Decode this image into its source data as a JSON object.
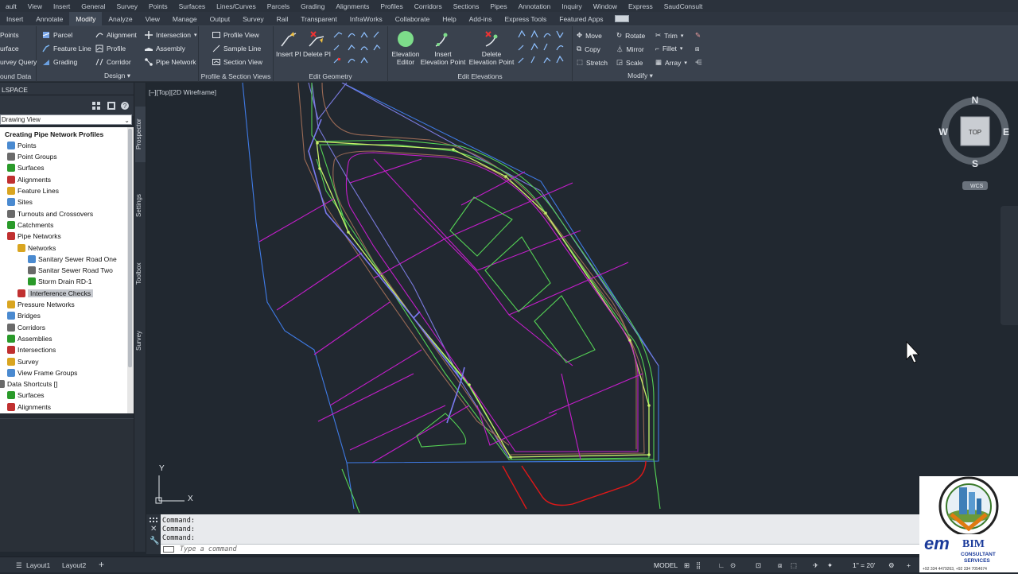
{
  "menubar": [
    "ault",
    "View",
    "Insert",
    "General",
    "Survey",
    "Points",
    "Surfaces",
    "Lines/Curves",
    "Parcels",
    "Grading",
    "Alignments",
    "Profiles",
    "Corridors",
    "Sections",
    "Pipes",
    "Annotation",
    "Inquiry",
    "Window",
    "Express",
    "SaudConsult"
  ],
  "ribbon_tabs": [
    "Insert",
    "Annotate",
    "Modify",
    "Analyze",
    "View",
    "Manage",
    "Output",
    "Survey",
    "Rail",
    "Transparent",
    "InfraWorks",
    "Collaborate",
    "Help",
    "Add-ins",
    "Express Tools",
    "Featured Apps"
  ],
  "active_tab": "Modify",
  "ribbon": {
    "ground": {
      "items": [
        "Points",
        "urface",
        "urvey Query"
      ],
      "title": "ound Data"
    },
    "design": {
      "col1": [
        "Parcel",
        "Feature Line",
        "Grading"
      ],
      "col2": [
        "Alignment",
        "Profile",
        "Corridor"
      ],
      "col3": [
        "Intersection",
        "Assembly",
        "Pipe Network"
      ],
      "title": "Design"
    },
    "psviews": {
      "items": [
        "Profile View",
        "Sample Line",
        "Section View"
      ],
      "title": "Profile & Section Views"
    },
    "geometry": {
      "insert_pi": "Insert PI",
      "delete_pi": "Delete PI",
      "title": "Edit Geometry"
    },
    "elevations": {
      "editor": "Elevation Editor",
      "insert": "Insert Elevation Point",
      "delete": "Delete Elevation Point",
      "title": "Edit Elevations"
    },
    "modify": {
      "col1": [
        "Move",
        "Copy",
        "Stretch"
      ],
      "col2": [
        "Rotate",
        "Mirror",
        "Scale"
      ],
      "col3": [
        "Trim",
        "Fillet",
        "Array"
      ],
      "title": "Modify"
    }
  },
  "toolspace": {
    "header": "LSPACE",
    "view_select": "Drawing View",
    "tree": [
      {
        "label": "Creating Pipe Network Profiles",
        "bold": true,
        "indent": 0
      },
      {
        "label": "Points",
        "indent": 1
      },
      {
        "label": "Point Groups",
        "indent": 1
      },
      {
        "label": "Surfaces",
        "indent": 1
      },
      {
        "label": "Alignments",
        "indent": 1
      },
      {
        "label": "Feature Lines",
        "indent": 1
      },
      {
        "label": "Sites",
        "indent": 1
      },
      {
        "label": "Turnouts and Crossovers",
        "indent": 1
      },
      {
        "label": "Catchments",
        "indent": 1
      },
      {
        "label": "Pipe Networks",
        "indent": 1
      },
      {
        "label": "Networks",
        "indent": 2
      },
      {
        "label": "Sanitary Sewer Road One",
        "indent": 3
      },
      {
        "label": "Sanitar Sewer Road Two",
        "indent": 3
      },
      {
        "label": "Storm Drain RD-1",
        "indent": 3
      },
      {
        "label": "Interference Checks",
        "indent": 2,
        "selected": true
      },
      {
        "label": "Pressure Networks",
        "indent": 1
      },
      {
        "label": "Bridges",
        "indent": 1
      },
      {
        "label": "Corridors",
        "indent": 1
      },
      {
        "label": "Assemblies",
        "indent": 1
      },
      {
        "label": "Intersections",
        "indent": 1
      },
      {
        "label": "Survey",
        "indent": 1
      },
      {
        "label": "View Frame Groups",
        "indent": 1
      },
      {
        "label": "Data Shortcuts []",
        "indent": 0
      },
      {
        "label": "Surfaces",
        "indent": 1
      },
      {
        "label": "Alignments",
        "indent": 1
      }
    ],
    "side_tabs": [
      "Prospector",
      "Settings",
      "Toolbox",
      "Survey"
    ]
  },
  "viewport": {
    "label": "[–][Top][2D Wireframe]",
    "viewcube": {
      "top": "TOP",
      "n": "N",
      "s": "S",
      "e": "E",
      "w": "W",
      "wcs": "WCS"
    },
    "ucs": {
      "x": "X",
      "y": "Y"
    }
  },
  "command": {
    "history": [
      "Command:",
      "Command:",
      "Command:"
    ],
    "placeholder": "Type a command"
  },
  "status": {
    "layouts": [
      "Layout1",
      "Layout2"
    ],
    "model": "MODEL",
    "scale": "1\" = 20'"
  },
  "logo": {
    "name": "BIM",
    "sub1": "CONSULTANT",
    "sub2": "SERVICES",
    "phones": "+92 334 4479263, +92 334 7054674",
    "ring": "ENGINEERING • CONSTRUCTION • SUPERVISION • DESIGN"
  },
  "colors": {
    "accent_green": "#6fdc6f",
    "alignment_yellowgreen": "#c8f06a",
    "boundary_blue": "#3f7be6",
    "parcel_magenta": "#c41ecb",
    "road_red": "#e01818"
  }
}
